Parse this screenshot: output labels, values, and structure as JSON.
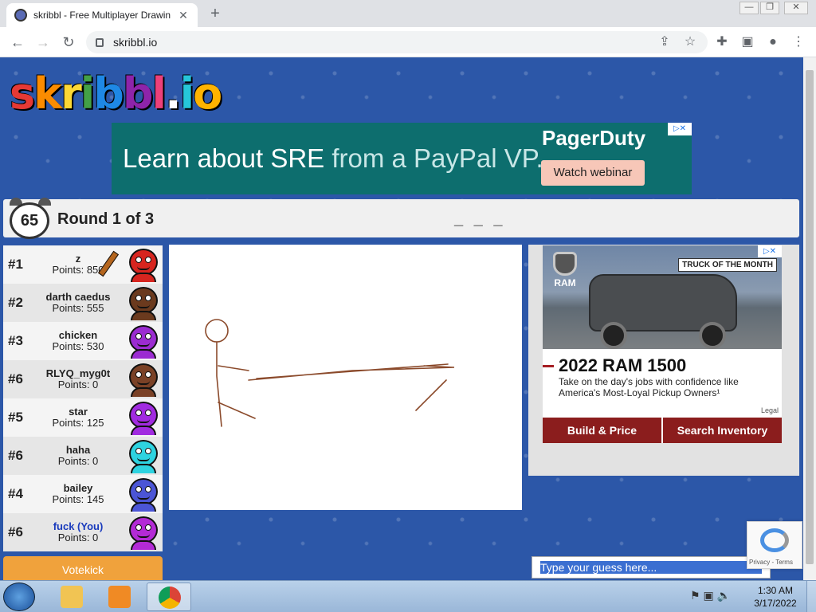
{
  "browser": {
    "tab_title": "skribbl - Free Multiplayer Drawin",
    "url": "skribbl.io",
    "new_tab": "+",
    "tab_close": "✕",
    "window_controls": [
      "—",
      "❐",
      "✕"
    ]
  },
  "site": {
    "logo_text": "skribbl.io"
  },
  "top_ad": {
    "headline_main": "Learn about SRE",
    "headline_soft": " from a PayPal VP.",
    "brand": "PagerDuty",
    "cta": "Watch webinar",
    "adchoice": "▷✕"
  },
  "game": {
    "timer": "65",
    "round_text": "Round 1 of 3",
    "word_hint": "_ _ _"
  },
  "players": [
    {
      "rank": "#1",
      "name": "z",
      "points": "Points: 850",
      "color": "#d7251f",
      "drawing": true
    },
    {
      "rank": "#2",
      "name": "darth caedus",
      "points": "Points: 555",
      "color": "#6b3a1e"
    },
    {
      "rank": "#3",
      "name": "chicken",
      "points": "Points: 530",
      "color": "#9b2bd1"
    },
    {
      "rank": "#6",
      "name": "RLYQ_myg0t",
      "points": "Points: 0",
      "color": "#7a4126"
    },
    {
      "rank": "#5",
      "name": "star",
      "points": "Points: 125",
      "color": "#a12be0"
    },
    {
      "rank": "#6",
      "name": "haha",
      "points": "Points: 0",
      "color": "#2ed3e0"
    },
    {
      "rank": "#4",
      "name": "bailey",
      "points": "Points: 145",
      "color": "#4b55d6"
    },
    {
      "rank": "#6",
      "name": "fuck (You)",
      "points": "Points: 0",
      "color": "#b32ad6",
      "you": true
    }
  ],
  "votekick": "Votekick",
  "side_ad": {
    "brand": "RAM",
    "badge": "TRUCK OF THE MONTH",
    "model": "2022 RAM 1500",
    "copy": "Take on the day's jobs with confidence like America's Most-Loyal Pickup Owners¹",
    "legal": "Legal",
    "btn_build": "Build & Price",
    "btn_search": "Search Inventory",
    "adchoice": "▷✕"
  },
  "chat": {
    "placeholder": "Type your guess here..."
  },
  "recaptcha": {
    "terms": "Privacy - Terms"
  },
  "taskbar": {
    "time": "1:30 AM",
    "date": "3/17/2022"
  },
  "colors": {
    "page_bg": "#2c57a8",
    "votekick": "#f0a23c",
    "ad_teal": "#0d6e6e",
    "ram_red": "#8b1d1d",
    "stroke_brown": "#8b4a2b"
  }
}
